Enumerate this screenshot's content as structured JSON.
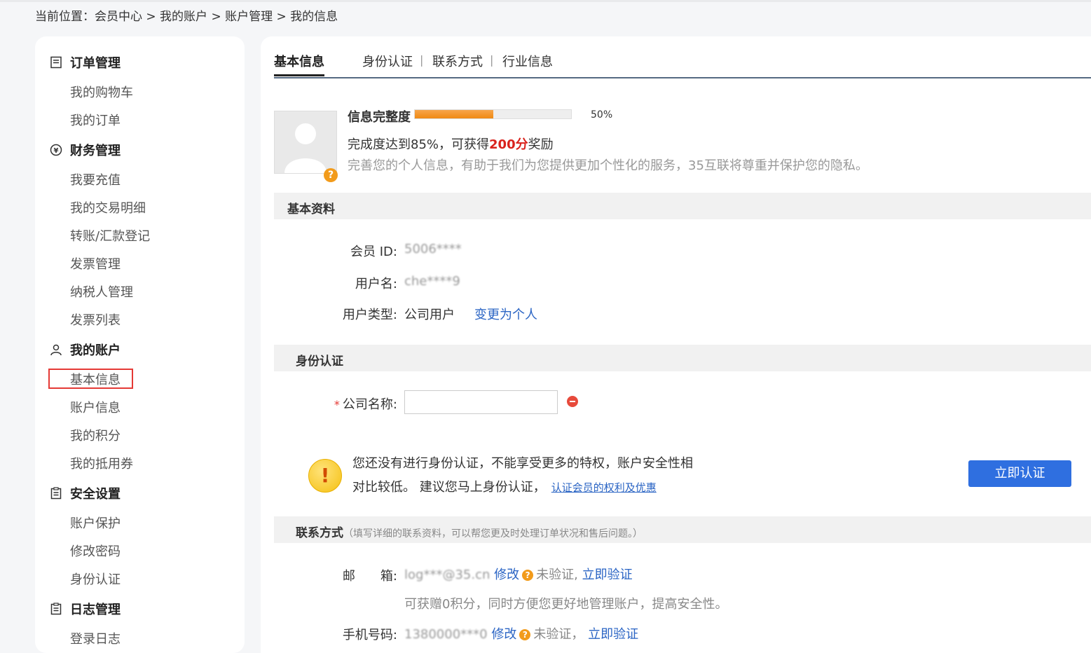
{
  "breadcrumb": {
    "prefix": "当前位置：",
    "path": "会员中心 > 我的账户 > 账户管理 > 我的信息"
  },
  "sidebar": {
    "groups": [
      {
        "title": "订单管理",
        "items": [
          "我的购物车",
          "我的订单"
        ]
      },
      {
        "title": "财务管理",
        "items": [
          "我要充值",
          "我的交易明细",
          "转账/汇款登记",
          "发票管理",
          "纳税人管理",
          "发票列表"
        ]
      },
      {
        "title": "我的账户",
        "items": [
          "基本信息",
          "账户信息",
          "我的积分",
          "我的抵用券"
        ]
      },
      {
        "title": "安全设置",
        "items": [
          "账户保护",
          "修改密码",
          "身份认证"
        ]
      },
      {
        "title": "日志管理",
        "items": [
          "登录日志"
        ]
      }
    ]
  },
  "tabs": [
    {
      "label": "基本信息",
      "active": true
    },
    {
      "label": "身份认证",
      "active": false
    },
    {
      "label": "联系方式",
      "active": false
    },
    {
      "label": "行业信息",
      "active": false
    }
  ],
  "tab_separator": "|",
  "completion": {
    "title": "信息完整度",
    "percent": 50,
    "percent_text": "50%",
    "reward_before": "完成度达到85%，可获得",
    "reward_points": "200分",
    "reward_after": "奖励",
    "tip": "完善您的个人信息，有助于我们为您提供更加个性化的服务，35互联将尊重并保护您的隐私。"
  },
  "basic": {
    "section_title": "基本资料",
    "member_id_label": "会员 ID:",
    "member_id_value": "5006****",
    "username_label": "用户名:",
    "username_value": "che****9",
    "user_type_label": "用户类型:",
    "user_type_value": "公司用户",
    "change_link": "变更为个人"
  },
  "identity": {
    "section_title": "身份认证",
    "company_label": "公司名称:",
    "company_value": "",
    "warn_line1": "您还没有进行身份认证，不能享受更多的特权，账户安全性相",
    "warn_line2": "对比较低。 建议您马上身份认证，",
    "warn_link": "认证会员的权利及优惠",
    "verify_button": "立即认证"
  },
  "contact": {
    "section_title": "联系方式",
    "section_note": "（填写详细的联系资料，可以帮您更及时处理订单状况和售后问题。）",
    "email_label": "邮　　箱:",
    "email_value": "log***@35.cn",
    "email_edit": "修改",
    "email_status": "未验证,",
    "email_verify": "立即验证",
    "email_tip": "可获赠0积分，同时方便您更好地管理账户，提高安全性。",
    "phone_label": "手机号码:",
    "phone_value": "1380000***0",
    "phone_edit": "修改",
    "phone_status": "未验证，",
    "phone_verify": "立即验证"
  }
}
